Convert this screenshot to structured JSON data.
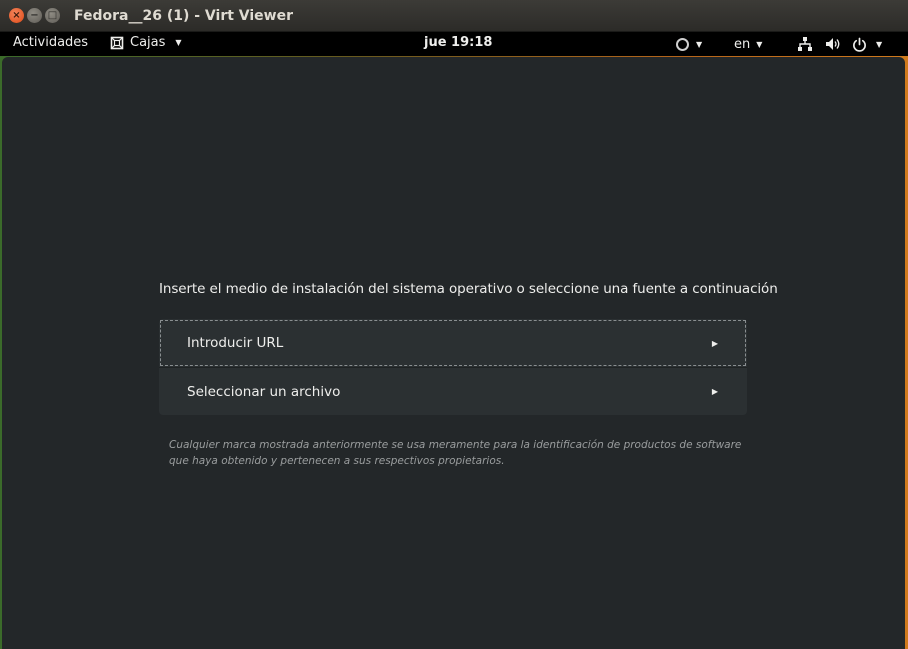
{
  "window": {
    "title": "Fedora__26 (1) - Virt Viewer",
    "close_glyph": "×",
    "minimize_glyph": "−",
    "maximize_glyph": "□"
  },
  "topbar": {
    "activities": "Actividades",
    "app_menu_label": "Cajas",
    "clock": "jue 19:18",
    "language": "en"
  },
  "main": {
    "prompt": "Inserte el medio de instalación del sistema operativo o seleccione una fuente a continuación",
    "sources": [
      {
        "label": "Introducir URL"
      },
      {
        "label": "Seleccionar un archivo"
      }
    ],
    "disclaimer": "Cualquier marca mostrada anteriormente se usa meramente para la identificación de productos de software que haya obtenido y pertenecen a sus respectivos propietarios."
  },
  "icons": {
    "app": "boxes-icon",
    "status": "circle-status-icon",
    "network": "network-icon",
    "volume": "volume-icon",
    "power": "power-icon",
    "dropdown": "caret-down-icon",
    "row_arrow": "chevron-right-icon"
  },
  "colors": {
    "screen_bg": "#232729",
    "list_bg": "#2b3032",
    "text": "#eeeeec",
    "muted_text": "#9a9d9e",
    "close_button": "#df4a16"
  }
}
